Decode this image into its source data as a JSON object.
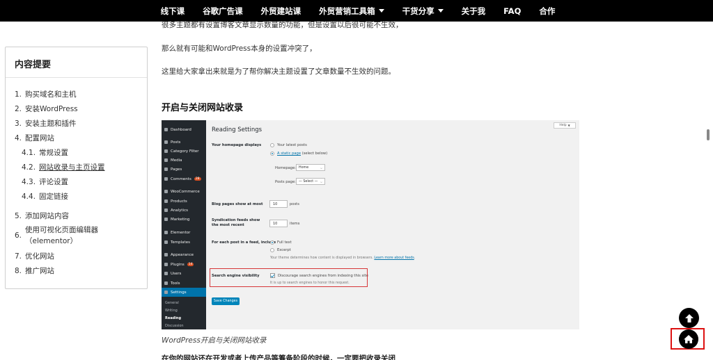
{
  "topnav": {
    "items": [
      {
        "label": "线下课",
        "dropdown": false
      },
      {
        "label": "谷歌广告课",
        "dropdown": false
      },
      {
        "label": "外贸建站课",
        "dropdown": false
      },
      {
        "label": "外贸营销工具箱",
        "dropdown": true
      },
      {
        "label": "干货分享",
        "dropdown": true
      },
      {
        "label": "关于我",
        "dropdown": false
      },
      {
        "label": "FAQ",
        "dropdown": false
      },
      {
        "label": "合作",
        "dropdown": false
      }
    ]
  },
  "toc": {
    "title": "内容提要",
    "items": [
      {
        "num": "1.",
        "label": "购买域名和主机"
      },
      {
        "num": "2.",
        "label": "安装WordPress"
      },
      {
        "num": "3.",
        "label": "安装主题和插件"
      },
      {
        "num": "4.",
        "label": "配置网站"
      },
      {
        "num": "4.1.",
        "label": "常规设置"
      },
      {
        "num": "4.2.",
        "label": "网站收录与主页设置"
      },
      {
        "num": "4.3.",
        "label": "评论设置"
      },
      {
        "num": "4.4.",
        "label": "固定链接"
      },
      {
        "num": "5.",
        "label": "添加网站内容"
      },
      {
        "num": "6.",
        "label": "使用可视化页面编辑器（elementor）"
      },
      {
        "num": "7.",
        "label": "优化网站"
      },
      {
        "num": "8.",
        "label": "推广网站"
      }
    ]
  },
  "article": {
    "para1": "很多主题都有设置博客文章显示数量的功能，但是设置以后很可能不生效，",
    "para2": "那么就有可能和WordPress本身的设置冲突了，",
    "para3": "这里给大家拿出来就是为了帮你解决主题设置了文章数量不生效的问题。",
    "heading": "开启与关闭网站收录",
    "caption": "WordPress开启与关闭网站收录",
    "cut_para": "在你的网站还在开发或者上传产品等筹备阶段的时候，一定要把收录关闭"
  },
  "wp": {
    "menu": [
      {
        "label": "Dashboard"
      },
      {
        "label": "Posts"
      },
      {
        "label": "Category Filter"
      },
      {
        "label": "Media"
      },
      {
        "label": "Pages"
      },
      {
        "label": "Comments",
        "badge": "28"
      },
      {
        "label": "WooCommerce"
      },
      {
        "label": "Products"
      },
      {
        "label": "Analytics"
      },
      {
        "label": "Marketing"
      },
      {
        "label": "Elementor"
      },
      {
        "label": "Templates"
      },
      {
        "label": "Appearance"
      },
      {
        "label": "Plugins",
        "badge": "14"
      },
      {
        "label": "Users"
      },
      {
        "label": "Tools"
      },
      {
        "label": "Settings"
      }
    ],
    "submenu": [
      "General",
      "Writing",
      "Reading",
      "Discussion"
    ],
    "title": "Reading Settings",
    "help": "Help",
    "homepage_label": "Your homepage displays",
    "opt_latest": "Your latest posts",
    "opt_static_link": "A static page",
    "opt_static_rest": " (select below)",
    "homepage_select_label": "Homepage:",
    "homepage_select_value": "Home",
    "postspage_select_label": "Posts page:",
    "postspage_select_value": "— Select —",
    "blog_label": "Blog pages show at most",
    "blog_value": "10",
    "blog_unit": "posts",
    "synd_label": "Syndication feeds show the most recent",
    "synd_value": "10",
    "synd_unit": "items",
    "feed_label": "For each post in a feed, include",
    "feed_full": "Full text",
    "feed_excerpt": "Excerpt",
    "feed_note_pre": "Your theme determines how content is displayed in browsers. ",
    "feed_note_link": "Learn more about feeds",
    "feed_note_post": ".",
    "sev_label": "Search engine visibility",
    "sev_check": "Discourage search engines from indexing this site",
    "sev_note": "It is up to search engines to honor this request.",
    "save_button": "Save Changes"
  }
}
